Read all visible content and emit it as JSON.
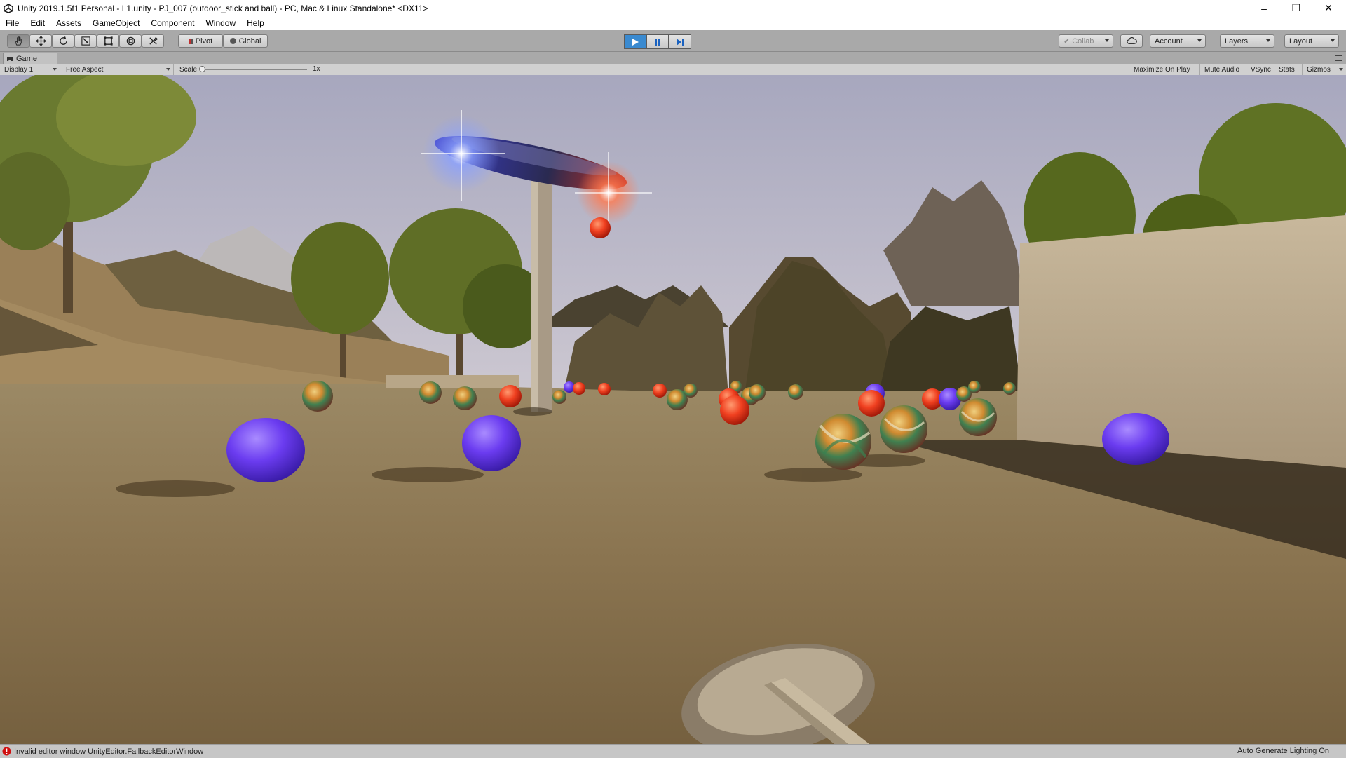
{
  "window": {
    "title": "Unity 2019.1.5f1 Personal - L1.unity - PJ_007 (outdoor_stick and  ball) - PC, Mac & Linux Standalone* <DX11>",
    "controls": {
      "minimize": "–",
      "restore": "❐",
      "close": "✕"
    }
  },
  "menu": [
    "File",
    "Edit",
    "Assets",
    "GameObject",
    "Component",
    "Window",
    "Help"
  ],
  "toolbar": {
    "tools": [
      "hand-tool",
      "move-tool",
      "rotate-tool",
      "scale-tool",
      "rect-tool",
      "transform-tool",
      "custom-tool"
    ],
    "pivot_label": "Pivot",
    "global_label": "Global",
    "collab_label": "Collab",
    "account_label": "Account",
    "layers_label": "Layers",
    "layout_label": "Layout",
    "play_state": "playing",
    "accent": "#3a8ad0"
  },
  "game_tab": {
    "label": "Game"
  },
  "game_bar": {
    "display": "Display 1",
    "aspect": "Free Aspect",
    "scale_label": "Scale",
    "scale_value": "1x",
    "scale_fraction": 0.0,
    "maximize": "Maximize On Play",
    "mute": "Mute Audio",
    "vsync": "VSync",
    "stats": "Stats",
    "gizmos": "Gizmos"
  },
  "status": {
    "error": "Invalid editor window UnityEditor.FallbackEditorWindow",
    "right": "Auto Generate Lighting On",
    "error_color": "#d01010"
  },
  "scene_colors": {
    "sky_top": "#b8b8cc",
    "ground": "#8a7450",
    "purple_ball": "#6b3cf0",
    "red_ball": "#f04020"
  }
}
